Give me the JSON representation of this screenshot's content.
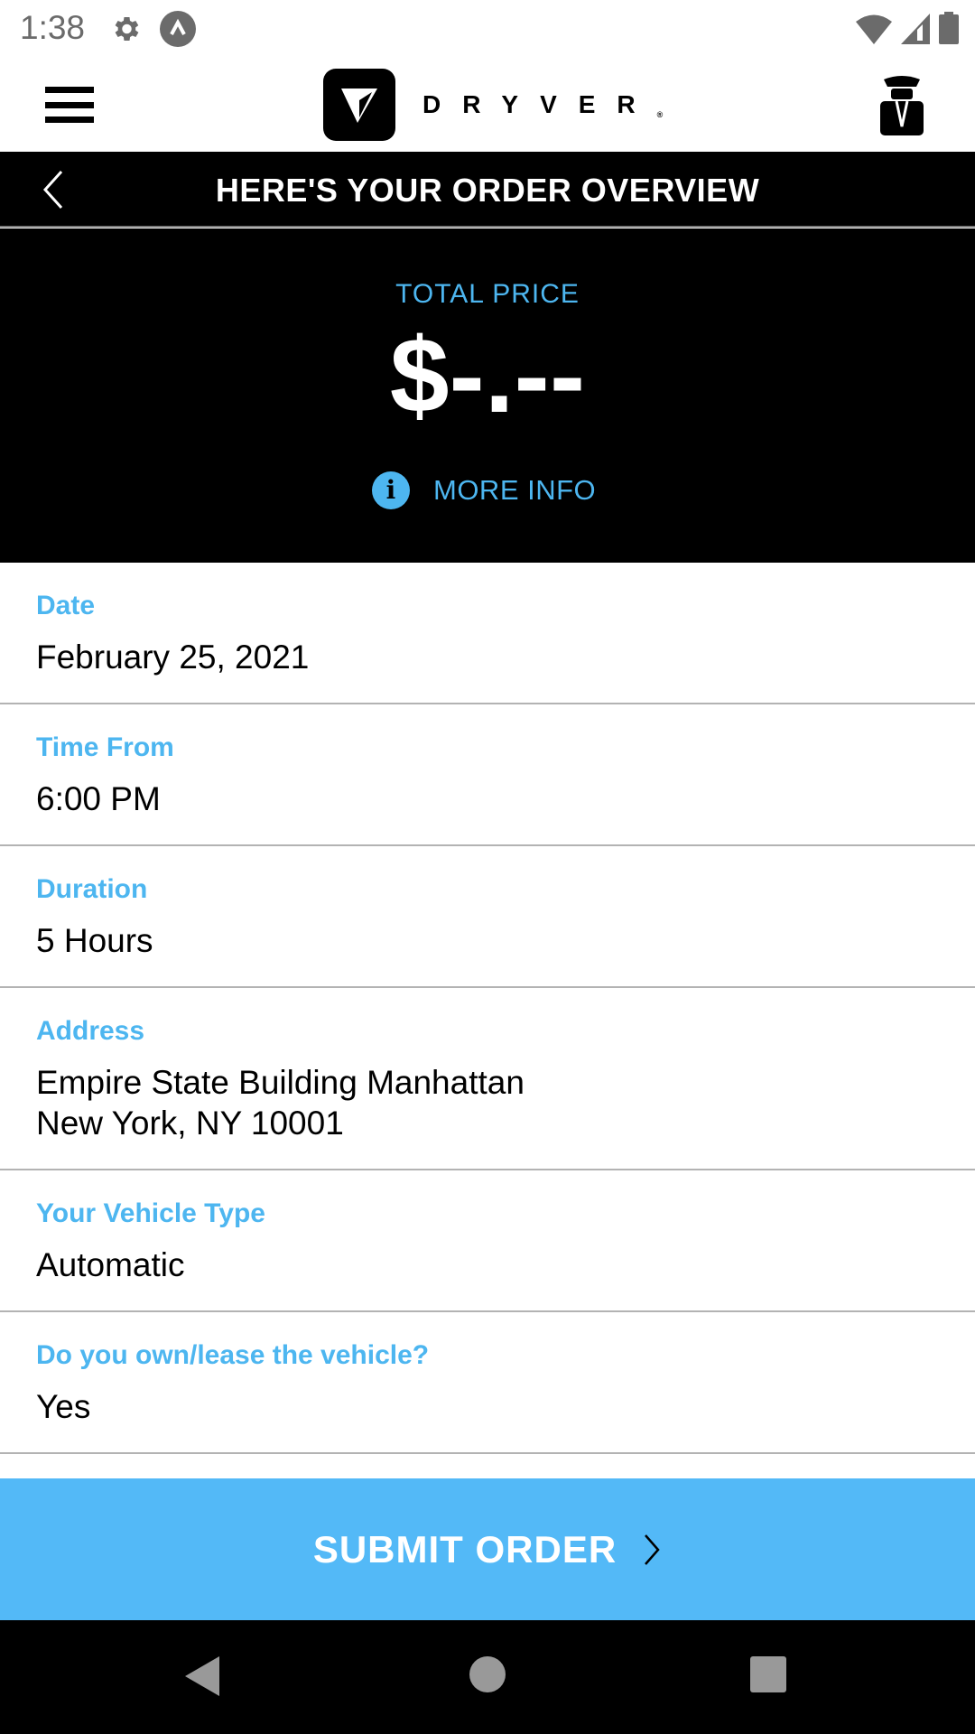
{
  "status_bar": {
    "time": "1:38",
    "left_icons": [
      "gear-icon",
      "app-notification-icon"
    ],
    "right_icons": [
      "wifi-icon",
      "cellular-signal-icon",
      "battery-icon"
    ]
  },
  "header": {
    "menu_icon": "hamburger-menu-icon",
    "brand_name": "DRYVER",
    "brand_mark": "®",
    "profile_icon": "chauffeur-icon"
  },
  "title_bar": {
    "back_icon": "chevron-left-icon",
    "title": "HERE'S YOUR ORDER OVERVIEW"
  },
  "price": {
    "label": "TOTAL PRICE",
    "value": "$-.--",
    "more_info_label": "MORE INFO",
    "more_info_icon": "info-icon"
  },
  "details": [
    {
      "label": "Date",
      "value": "February 25, 2021"
    },
    {
      "label": "Time From",
      "value": "6:00 PM"
    },
    {
      "label": "Duration",
      "value": "5 Hours"
    },
    {
      "label": "Address",
      "value_line1": "Empire State Building Manhattan",
      "value_line2": "New York, NY 10001"
    },
    {
      "label": "Your Vehicle Type",
      "value": "Automatic"
    },
    {
      "label": "Do you own/lease the vehicle?",
      "value": "Yes"
    }
  ],
  "submit": {
    "label": "SUBMIT ORDER",
    "icon": "chevron-right-icon"
  },
  "colors": {
    "accent": "#4db6f0",
    "submit_bg": "#53b9f7",
    "dark": "#000000"
  },
  "nav_bar": {
    "buttons": [
      "back",
      "home",
      "recents"
    ]
  }
}
